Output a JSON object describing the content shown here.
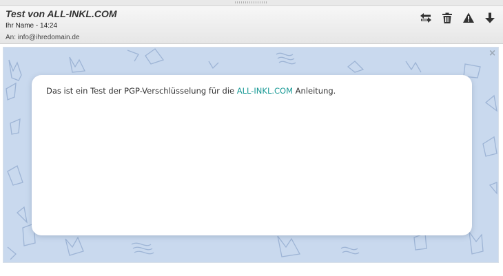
{
  "message": {
    "subject": "Test von ALL-INKL.COM",
    "from_line": "Ihr Name - 14:24",
    "to_line": "An: info@ihredomain.de"
  },
  "toolbar": {
    "icons": [
      "reply-forward-icon",
      "trash-icon",
      "warning-icon",
      "download-icon"
    ]
  },
  "body": {
    "text_before": "Das ist ein Test der PGP-Verschlüsselung für die ",
    "link_text": "ALL-INKL.COM",
    "text_after": " Anleitung."
  },
  "close_label": "×",
  "colors": {
    "background_pattern": "#c9d9ee",
    "link": "#1a9a96",
    "icon": "#333333"
  }
}
